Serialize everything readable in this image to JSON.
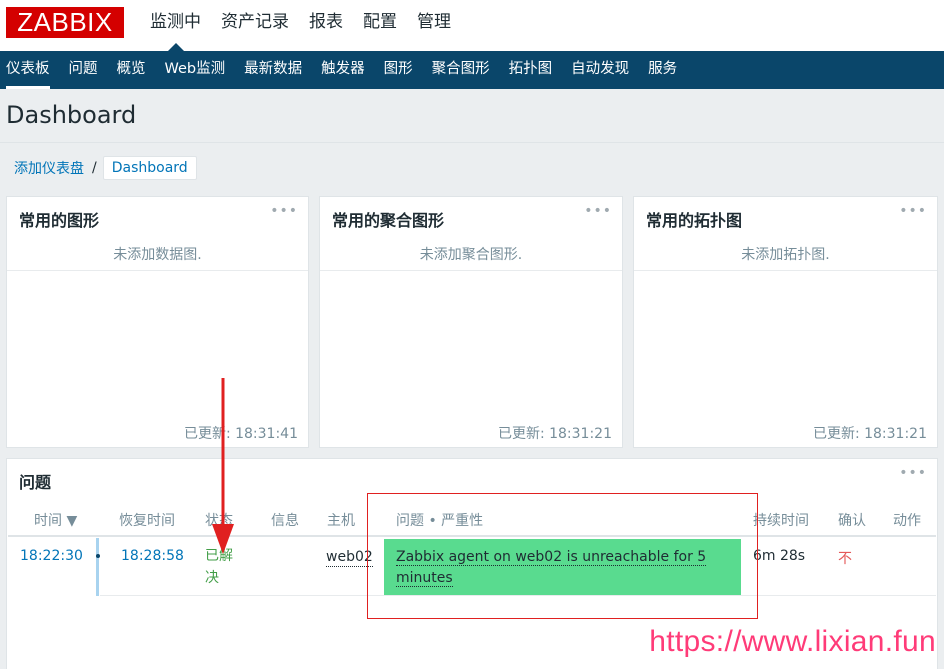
{
  "header": {
    "logo": "ZABBIX",
    "nav": [
      "监测中",
      "资产记录",
      "报表",
      "配置",
      "管理"
    ]
  },
  "subnav": [
    "仪表板",
    "问题",
    "概览",
    "Web监测",
    "最新数据",
    "触发器",
    "图形",
    "聚合图形",
    "拓扑图",
    "自动发现",
    "服务"
  ],
  "page": {
    "title": "Dashboard"
  },
  "breadcrumb": {
    "parent": "添加仪表盘",
    "separator": "/",
    "current": "Dashboard"
  },
  "widgets": [
    {
      "title": "常用的图形",
      "message": "未添加数据图.",
      "updated": "已更新: 18:31:41"
    },
    {
      "title": "常用的聚合图形",
      "message": "未添加聚合图形.",
      "updated": "已更新: 18:31:21"
    },
    {
      "title": "常用的拓扑图",
      "message": "未添加拓扑图.",
      "updated": "已更新: 18:31:21"
    }
  ],
  "widget_menu": "•••",
  "problems": {
    "title": "问题",
    "columns": [
      "时间 ▼",
      "恢复时间",
      "状态",
      "信息",
      "主机",
      "问题 • 严重性",
      "持续时间",
      "确认",
      "动作"
    ],
    "rows": [
      {
        "time": "18:22:30",
        "recovery_time": "18:28:58",
        "status": "已解决",
        "info": "",
        "host": "web02",
        "problem": "Zabbix agent on web02 is unreachable for 5 minutes",
        "duration": "6m 28s",
        "ack": "不",
        "actions": ""
      }
    ]
  },
  "colors": {
    "brand": "#d40000",
    "subnav": "#0a466a",
    "link": "#0275b8",
    "resolved": "#429e47",
    "severity": "#59db8f",
    "ack_no": "#e45959"
  },
  "watermark": "https://www.lixian.fun"
}
